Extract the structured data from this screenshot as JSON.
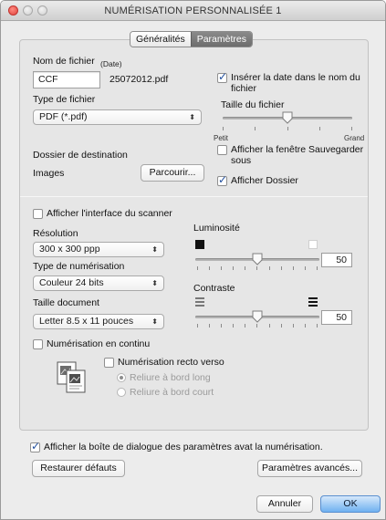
{
  "window": {
    "title": "NUMÉRISATION PERSONNALISÉE 1"
  },
  "tabs": [
    {
      "label": "Généralités",
      "active": false
    },
    {
      "label": "Paramètres",
      "active": true
    }
  ],
  "file": {
    "name_label": "Nom de fichier",
    "date_label": "(Date)",
    "name_value": "CCF",
    "generated_name": "25072012.pdf",
    "insert_date_label": "Insérer la date dans le nom du fichier",
    "insert_date_checked": true,
    "type_label": "Type de fichier",
    "type_value": "PDF (*.pdf)",
    "size_label": "Taille du fichier",
    "size_min_label": "Petit",
    "size_max_label": "Grand",
    "size_level": 0.5
  },
  "destination": {
    "label": "Dossier de destination",
    "folder": "Images",
    "browse_label": "Parcourir...",
    "show_save_window_label": "Afficher la fenêtre Sauvegarder sous",
    "show_save_window_checked": false,
    "show_folder_label": "Afficher Dossier",
    "show_folder_checked": true
  },
  "scanner": {
    "show_interface_label": "Afficher l'interface du scanner",
    "show_interface_checked": false,
    "resolution_label": "Résolution",
    "resolution_value": "300 x 300 ppp",
    "scan_type_label": "Type de numérisation",
    "scan_type_value": "Couleur 24 bits",
    "doc_size_label": "Taille document",
    "doc_size_value": "Letter 8.5 x 11 pouces",
    "brightness_label": "Luminosité",
    "brightness_value": "50",
    "brightness_level": 0.5,
    "contrast_label": "Contraste",
    "contrast_value": "50",
    "contrast_level": 0.5,
    "continuous_label": "Numérisation en continu",
    "continuous_checked": false,
    "duplex_label": "Numérisation recto verso",
    "duplex_checked": false,
    "long_edge_label": "Reliure à bord long",
    "long_edge_selected": true,
    "short_edge_label": "Reliure à bord court",
    "short_edge_selected": false
  },
  "footer": {
    "show_dialog_label": "Afficher la boîte de dialogue des paramètres avat la numérisation.",
    "show_dialog_checked": true,
    "restore_label": "Restaurer défauts",
    "advanced_label": "Paramètres avancés...",
    "cancel_label": "Annuler",
    "ok_label": "OK"
  },
  "colors": {
    "accent": "#6fb1f0",
    "check": "#1f4e9e",
    "close": "#e0443e"
  }
}
